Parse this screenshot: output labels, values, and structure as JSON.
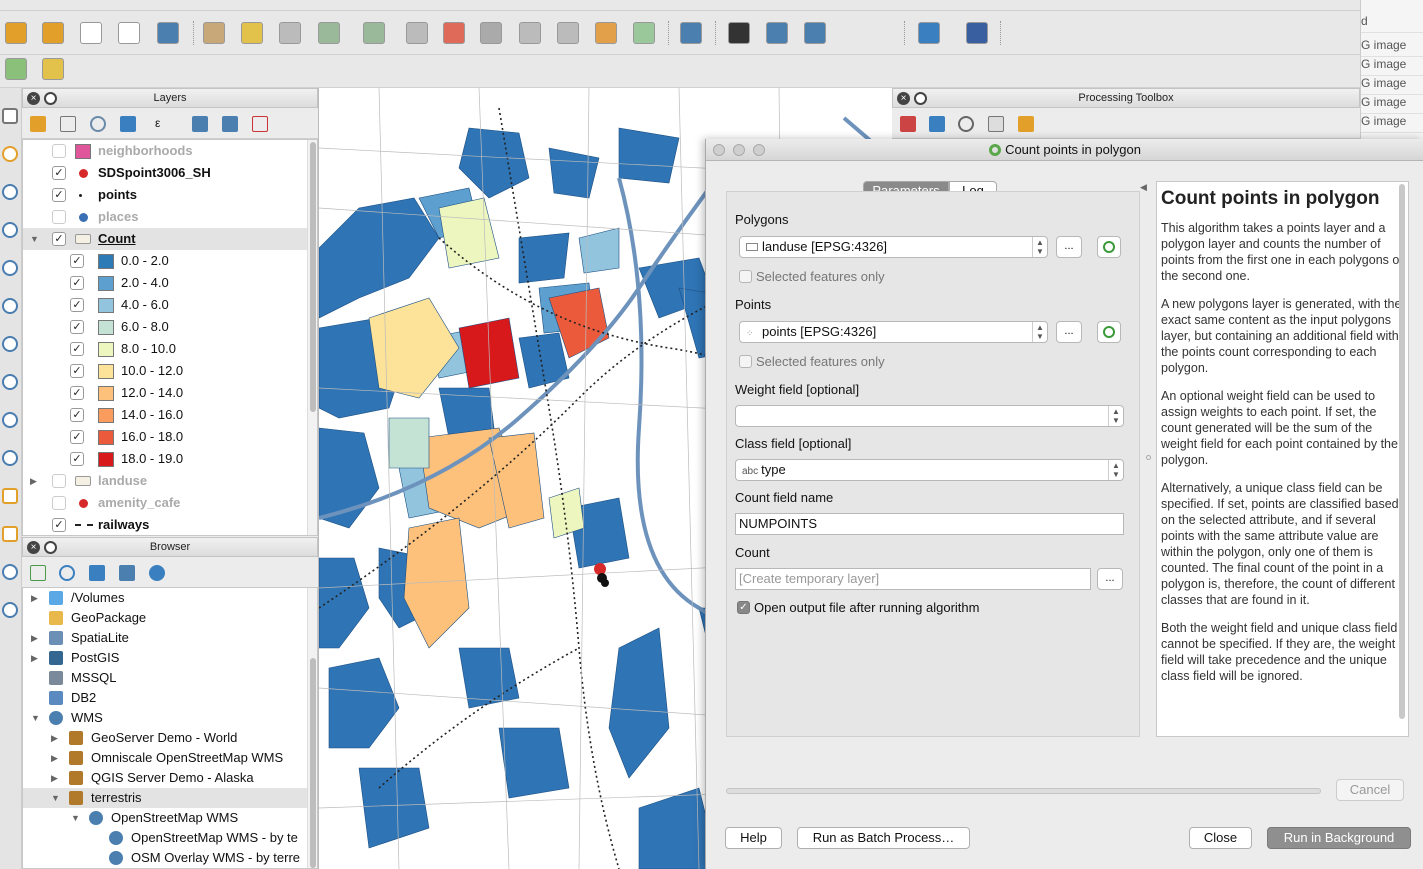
{
  "right_strip": {
    "items": [
      "G image",
      "G image",
      "G image",
      "G image",
      "G image"
    ],
    "top_label": "d"
  },
  "layers_panel": {
    "title": "Layers",
    "rows": [
      {
        "label": "neighborhoods",
        "checked": false,
        "swatch": "#e0569a",
        "kind": "fill",
        "dim": true
      },
      {
        "label": "SDSpoint3006_SH",
        "checked": true,
        "swatch": "#d62a2a",
        "kind": "dot",
        "bold": true
      },
      {
        "label": "points",
        "checked": true,
        "swatch": "#222",
        "kind": "smalldot",
        "bold": true
      },
      {
        "label": "places",
        "checked": false,
        "swatch": "#3a6fb5",
        "kind": "dot",
        "dim": true
      },
      {
        "label": "Count",
        "checked": true,
        "kind": "group",
        "bold": true,
        "selected": true
      },
      {
        "label": "0.0 - 2.0",
        "checked": true,
        "swatch": "#2c7bb6",
        "kind": "class"
      },
      {
        "label": "2.0 - 4.0",
        "checked": true,
        "swatch": "#5d9fcf",
        "kind": "class"
      },
      {
        "label": "4.0 - 6.0",
        "checked": true,
        "swatch": "#92c4de",
        "kind": "class"
      },
      {
        "label": "6.0 - 8.0",
        "checked": true,
        "swatch": "#c4e3d4",
        "kind": "class"
      },
      {
        "label": "8.0 - 10.0",
        "checked": true,
        "swatch": "#eef6c0",
        "kind": "class"
      },
      {
        "label": "10.0 - 12.0",
        "checked": true,
        "swatch": "#fde39a",
        "kind": "class"
      },
      {
        "label": "12.0 - 14.0",
        "checked": true,
        "swatch": "#fdc17b",
        "kind": "class"
      },
      {
        "label": "14.0 - 16.0",
        "checked": true,
        "swatch": "#f99c5d",
        "kind": "class"
      },
      {
        "label": "16.0 - 18.0",
        "checked": true,
        "swatch": "#ec5a3c",
        "kind": "class"
      },
      {
        "label": "18.0 - 19.0",
        "checked": true,
        "swatch": "#d7191c",
        "kind": "class"
      },
      {
        "label": "landuse",
        "checked": false,
        "kind": "group",
        "dim": true
      },
      {
        "label": "amenity_cafe",
        "checked": false,
        "swatch": "#d62a2a",
        "kind": "dot",
        "dim": true
      },
      {
        "label": "railways",
        "checked": true,
        "kind": "line",
        "bold": true
      }
    ]
  },
  "browser_panel": {
    "title": "Browser",
    "rows": [
      {
        "label": "/Volumes",
        "indent": 0,
        "arrow": "right",
        "icon": "#5aa9e6"
      },
      {
        "label": "GeoPackage",
        "indent": 0,
        "arrow": "",
        "icon": "#e8b84a"
      },
      {
        "label": "SpatiaLite",
        "indent": 0,
        "arrow": "right",
        "icon": "#6b8fb5"
      },
      {
        "label": "PostGIS",
        "indent": 0,
        "arrow": "right",
        "icon": "#336791"
      },
      {
        "label": "MSSQL",
        "indent": 0,
        "arrow": "",
        "icon": "#7a8a9a"
      },
      {
        "label": "DB2",
        "indent": 0,
        "arrow": "",
        "icon": "#5a8ac0"
      },
      {
        "label": "WMS",
        "indent": 0,
        "arrow": "down",
        "icon": "#4a7fb0"
      },
      {
        "label": "GeoServer Demo - World",
        "indent": 1,
        "arrow": "right",
        "icon": "#b07a2a"
      },
      {
        "label": "Omniscale OpenStreetMap WMS",
        "indent": 1,
        "arrow": "right",
        "icon": "#b07a2a"
      },
      {
        "label": "QGIS Server Demo - Alaska",
        "indent": 1,
        "arrow": "right",
        "icon": "#b07a2a"
      },
      {
        "label": "terrestris",
        "indent": 1,
        "arrow": "down",
        "icon": "#b07a2a",
        "selected": true
      },
      {
        "label": "OpenStreetMap WMS",
        "indent": 2,
        "arrow": "down",
        "icon": "#4a7fb0"
      },
      {
        "label": "OpenStreetMap WMS - by te",
        "indent": 3,
        "arrow": "",
        "icon": "#4a7fb0"
      },
      {
        "label": "OSM Overlay WMS - by terre",
        "indent": 3,
        "arrow": "",
        "icon": "#4a7fb0"
      }
    ]
  },
  "processing_toolbox": {
    "title": "Processing Toolbox"
  },
  "dialog": {
    "title": "Count points in polygon",
    "tabs": [
      "Parameters",
      "Log"
    ],
    "polygons_label": "Polygons",
    "polygons_value": "landuse [EPSG:4326]",
    "selected_only_label": "Selected features only",
    "points_label": "Points",
    "points_value": "points [EPSG:4326]",
    "weight_label": "Weight field [optional]",
    "weight_value": "",
    "class_label": "Class field [optional]",
    "class_prefix": "abc",
    "class_value": "type",
    "countname_label": "Count field name",
    "countname_value": "NUMPOINTS",
    "count_label": "Count",
    "count_placeholder": "[Create temporary layer]",
    "ellipsis": "...",
    "open_output_label": "Open output file after running algorithm",
    "help_title": "Count points in polygon",
    "help_paragraphs": [
      "This algorithm takes a points layer and a polygon layer and counts the number of points from the first one in each polygons of the second one.",
      "A new polygons layer is generated, with the exact same content as the input polygons layer, but containing an additional field with the points count corresponding to each polygon.",
      "An optional weight field can be used to assign weights to each point. If set, the count generated will be the sum of the weight field for each point contained by the polygon.",
      "Alternatively, a unique class field can be specified. If set, points are classified based on the selected attribute, and if several points with the same attribute value are within the polygon, only one of them is counted. The final count of the point in a polygon is, therefore, the count of different classes that are found in it.",
      "Both the weight field and unique class field cannot be specified. If they are, the weight field will take precedence and the unique class field will be ignored."
    ],
    "cancel": "Cancel",
    "help_button": "Help",
    "batch_button": "Run as Batch Process…",
    "close_button": "Close",
    "run_button": "Run in Background"
  }
}
